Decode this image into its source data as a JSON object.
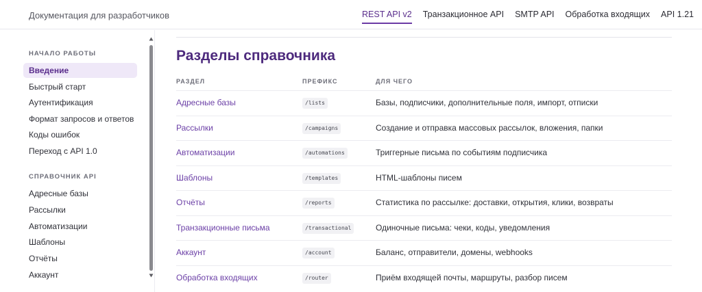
{
  "header": {
    "brand": "Документация для разработчиков",
    "nav": [
      {
        "label": "REST API v2",
        "active": true
      },
      {
        "label": "Транзакционное API",
        "active": false
      },
      {
        "label": "SMTP API",
        "active": false
      },
      {
        "label": "Обработка входящих",
        "active": false
      },
      {
        "label": "API 1.21",
        "active": false
      }
    ]
  },
  "sidebar": {
    "sections": [
      {
        "title": "НАЧАЛО РАБОТЫ",
        "items": [
          {
            "label": "Введение",
            "active": true
          },
          {
            "label": "Быстрый старт",
            "active": false
          },
          {
            "label": "Аутентификация",
            "active": false
          },
          {
            "label": "Формат запросов и ответов",
            "active": false
          },
          {
            "label": "Коды ошибок",
            "active": false
          },
          {
            "label": "Переход с API 1.0",
            "active": false
          }
        ]
      },
      {
        "title": "СПРАВОЧНИК API",
        "items": [
          {
            "label": "Адресные базы",
            "active": false
          },
          {
            "label": "Рассылки",
            "active": false
          },
          {
            "label": "Автоматизации",
            "active": false
          },
          {
            "label": "Шаблоны",
            "active": false
          },
          {
            "label": "Отчёты",
            "active": false
          },
          {
            "label": "Аккаунт",
            "active": false
          }
        ]
      }
    ]
  },
  "main": {
    "title": "Разделы справочника",
    "columns": [
      "РАЗДЕЛ",
      "ПРЕФИКС",
      "ДЛЯ ЧЕГО"
    ],
    "rows": [
      {
        "name": "Адресные базы",
        "prefix": "/lists",
        "desc": "Базы, подписчики, дополнительные поля, импорт, отписки"
      },
      {
        "name": "Рассылки",
        "prefix": "/campaigns",
        "desc": "Создание и отправка массовых рассылок, вложения, папки"
      },
      {
        "name": "Автоматизации",
        "prefix": "/automations",
        "desc": "Триггерные письма по событиям подписчика"
      },
      {
        "name": "Шаблоны",
        "prefix": "/templates",
        "desc": "HTML-шаблоны писем"
      },
      {
        "name": "Отчёты",
        "prefix": "/reports",
        "desc": "Статистика по рассылке: доставки, открытия, клики, возвраты"
      },
      {
        "name": "Транзакционные письма",
        "prefix": "/transactional",
        "desc": "Одиночные письма: чеки, коды, уведомления"
      },
      {
        "name": "Аккаунт",
        "prefix": "/account",
        "desc": "Баланс, отправители, домены, webhooks"
      },
      {
        "name": "Обработка входящих",
        "prefix": "/router",
        "desc": "Приём входящей почты, маршруты, разбор писем"
      }
    ]
  },
  "colors": {
    "accent": "#6b3fa6",
    "title": "#4d2a7d",
    "active_bg": "#efe8f8"
  }
}
